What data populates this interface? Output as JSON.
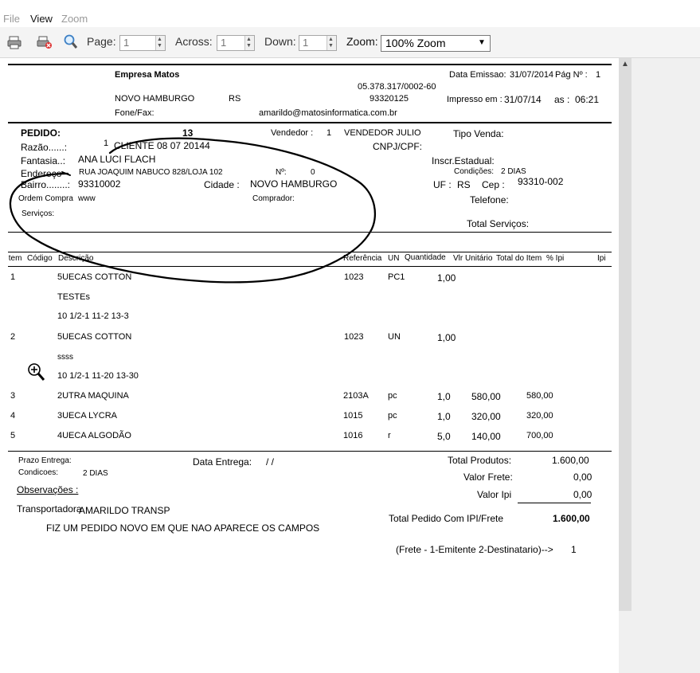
{
  "menu": {
    "file": "File",
    "view": "View",
    "zoom": "Zoom"
  },
  "toolbar": {
    "page_label": "Page:",
    "page_value": "1",
    "across_label": "Across:",
    "across_value": "1",
    "down_label": "Down:",
    "down_value": "1",
    "zoom_label": "Zoom:",
    "zoom_value": "100% Zoom"
  },
  "header": {
    "company": "Empresa Matos",
    "cnpj": "05.378.317/0002-60",
    "city": "NOVO HAMBURGO",
    "state": "RS",
    "cep": "93320125",
    "fone_label": "Fone/Fax:",
    "email": "amarildo@matosinformatica.com.br",
    "emission_label": "Data Emissao:",
    "emission_date": "31/07/2014",
    "page_label": "Pág Nº :",
    "page_num": "1",
    "printed_label": "Impresso em :",
    "printed_date": "31/07/14",
    "time_label": "as :",
    "time": "06:21"
  },
  "order": {
    "pedido_label": "PEDIDO:",
    "pedido_num": "13",
    "vendedor_label": "Vendedor :",
    "vendedor_code": "1",
    "vendedor_name": "VENDEDOR JULIO",
    "tipo_venda_label": "Tipo Venda:",
    "razao_label": "Razão......:",
    "razao_code": "1",
    "razao_value": "CLIENTE 08 07 20144",
    "cnpj_label": "CNPJ/CPF:",
    "fantasia_label": "Fantasia..:",
    "fantasia_value": "ANA LUCI FLACH",
    "inscr_label": "Inscr.Estadual:",
    "endereco_label": "Endereço",
    "endereco_value": "RUA JOAQUIM NABUCO 828/LOJA 102",
    "numero_label": "Nº:",
    "numero_value": "0",
    "condicoes_label": "Condições:",
    "condicoes_value": "2 DIAS",
    "bairro_label": "Bairro........:",
    "bairro_value": "93310002",
    "cidade_label": "Cidade :",
    "cidade_value": "NOVO HAMBURGO",
    "uf_label": "UF :",
    "uf_value": "RS",
    "cep_label": "Cep :",
    "cep_value": "93310-002",
    "ordem_label": "Ordem Compra",
    "ordem_value": "www",
    "comprador_label": "Comprador:",
    "telefone_label": "Telefone:",
    "servicos_label": "Serviços:",
    "total_servicos_label": "Total Serviços:"
  },
  "table": {
    "headers": {
      "item": "Item",
      "codigo": "Código",
      "descricao": "Descrição",
      "referencia": "Referência",
      "un": "UN",
      "quantidade": "Quantidade",
      "vlr_unit": "Vlr Unitário",
      "total_item": "Total do Item",
      "pct_ipi": "% Ipi",
      "ipi": "Ipi"
    },
    "rows": [
      {
        "item": "1",
        "desc": "5UECAS COTTON",
        "ref": "1023",
        "un": "PC1",
        "qty": "1,00",
        "unit": "",
        "total": ""
      },
      {
        "item": "",
        "desc": "TESTEs",
        "ref": "",
        "un": "",
        "qty": "",
        "unit": "",
        "total": ""
      },
      {
        "item": "",
        "desc": "10 1/2-1  11-2  13-3",
        "ref": "",
        "un": "",
        "qty": "",
        "unit": "",
        "total": ""
      },
      {
        "item": "2",
        "desc": "5UECAS COTTON",
        "ref": "1023",
        "un": "UN",
        "qty": "1,00",
        "unit": "",
        "total": ""
      },
      {
        "item": "",
        "desc": "ssss",
        "ref": "",
        "un": "",
        "qty": "",
        "unit": "",
        "total": ""
      },
      {
        "item": "",
        "desc": "10 1/2-1  11-20  13-30",
        "ref": "",
        "un": "",
        "qty": "",
        "unit": "",
        "total": ""
      },
      {
        "item": "3",
        "desc": "2UTRA MAQUINA",
        "ref": "2103A",
        "un": "pc",
        "qty": "1,0",
        "unit": "580,00",
        "total": "580,00"
      },
      {
        "item": "4",
        "desc": "3UECA LYCRA",
        "ref": "1015",
        "un": "pc",
        "qty": "1,0",
        "unit": "320,00",
        "total": "320,00"
      },
      {
        "item": "5",
        "desc": "4UECA ALGODÃO",
        "ref": "1016",
        "un": "r",
        "qty": "5,0",
        "unit": "140,00",
        "total": "700,00"
      }
    ]
  },
  "footer": {
    "prazo_label": "Prazo Entrega:",
    "data_entrega_label": "Data Entrega:",
    "data_entrega_value": "/  /",
    "condicoes_label": "Condicoes:",
    "condicoes_value": "2 DIAS",
    "observacoes_label": "Observações :",
    "transportadora_label": "Transportadora",
    "transportadora_value": "AMARILDO TRANSP",
    "note": "FIZ UM PEDIDO NOVO EM QUE NAO APARECE OS CAMPOS",
    "total_produtos_label": "Total Produtos:",
    "total_produtos_value": "1.600,00",
    "valor_frete_label": "Valor Frete:",
    "valor_frete_value": "0,00",
    "valor_ipi_label": "Valor Ipi",
    "valor_ipi_value": "0,00",
    "total_pedido_label": "Total Pedido Com IPI/Frete",
    "total_pedido_value": "1.600,00",
    "frete_label": "(Frete - 1-Emitente 2-Destinatario)-->",
    "frete_value": "1"
  }
}
